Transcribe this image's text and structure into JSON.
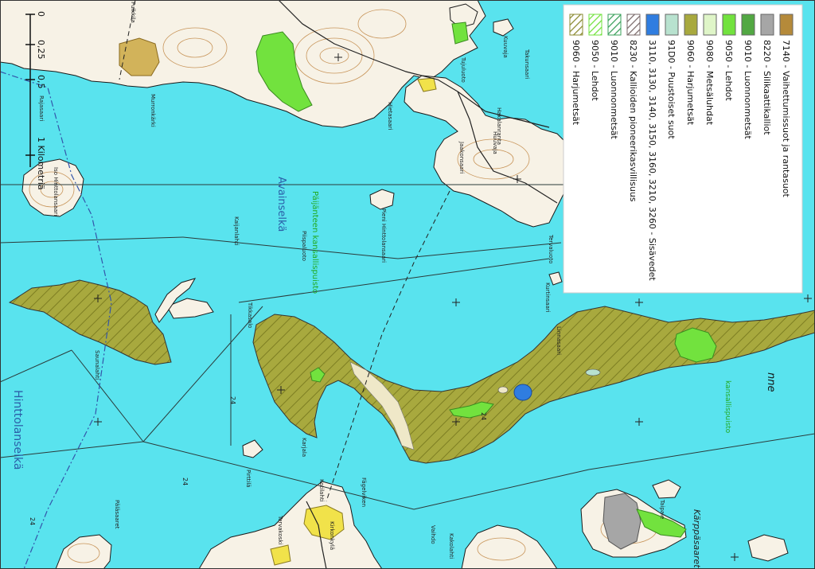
{
  "legend": {
    "items": [
      {
        "code_label": "7140 - Vaihettumissuot ja rantasuot",
        "color": "#b58a3a",
        "pattern": "solid"
      },
      {
        "code_label": "8220 - Silikaattikalliot",
        "color": "#a6a6a6",
        "pattern": "solid"
      },
      {
        "code_label": "9010 - Luonnonmetsät",
        "color": "#52a843",
        "pattern": "solid"
      },
      {
        "code_label": "9050 - Lehdot",
        "color": "#72e23e",
        "pattern": "solid"
      },
      {
        "code_label": "9080 - Metsäluhdat",
        "color": "#dff5c8",
        "pattern": "solid"
      },
      {
        "code_label": "9060 - Harjumetsät",
        "color": "#a8a93e",
        "pattern": "solid"
      },
      {
        "code_label": "91D0 - Puustoiset suot",
        "color": "#b8e2cf",
        "pattern": "solid"
      },
      {
        "code_label": "3110, 3130, 3140, 3150, 3160, 3210, 3260 - Sisävedet",
        "color": "#2f7de0",
        "pattern": "solid"
      },
      {
        "code_label": "8230 - Kallioiden pioneerikasvillisuus",
        "color": "#7a6a6a",
        "pattern": "hatch"
      },
      {
        "code_label": "9010 - Luonnonmetsät",
        "color": "#3aa05a",
        "pattern": "hatch"
      },
      {
        "code_label": "9050 - Lehdot",
        "color": "#72e23e",
        "pattern": "hatch"
      },
      {
        "code_label": "9060 - Harjumetsät",
        "color": "#8a8a30",
        "pattern": "hatch"
      }
    ]
  },
  "scale_bar": {
    "tick_0": "0",
    "tick_025": "0,25",
    "tick_05": "0,5",
    "tick_1": "1 Kilometriä"
  },
  "water_labels": {
    "avainselka": "Avainselkä",
    "hinttolanselka": "Hinttolanselkä",
    "nne": "nne"
  },
  "park_labels": {
    "paijanne_kansallispuisto": "Päijänteen kansallispuisto",
    "kansallispuisto": "kansallispuisto"
  },
  "place_labels": {
    "murronkarki": "Murronkärki",
    "rajasaari": "Rajasaari",
    "isosaari": "Iso Hinttolansaari",
    "pieni_hinttola": "Pieni Hinttolansaari",
    "kaijanlahti": "Kaijanlahti",
    "piispaluoto": "Piispaluoto",
    "tikkasalo": "Tikkasalo",
    "palasaaret": "Päläsaaret",
    "karppasaaret": "Kärppäsaaret",
    "kurtinsaari": "Kurtinsaari",
    "hakalanranta": "Hakalanranta",
    "huuvaja": "Huuvaja",
    "tervaluoto": "Tervaluoto",
    "linnasaari": "Linnasaari",
    "jaakonsaari": "Jaakonsaari",
    "karjala": "Karjala",
    "pirttila": "Pirttilä",
    "kotilahti": "Kotilahti",
    "pulkkila": "Pulkkila",
    "hietasaari": "Hietasaari",
    "kuuvaja": "Kuuvaja",
    "takunsaari": "Takunsaari",
    "tujuluoto": "Tujuluoto",
    "fagelviken": "Fägelviken",
    "kirkonkyla": "Kirkonkylä",
    "tervakoski": "Tervakoski",
    "vaihdo": "Vaihdo",
    "kakolahti": "Kakolahti",
    "taipale": "Taipale",
    "saunalahti": "Saunalahti"
  },
  "depth_labels": {
    "d24a": "24",
    "d24b": "24",
    "d24c": "24",
    "d24d": "24"
  },
  "colors": {
    "water": "#59e3ee",
    "land": "#f7f2e6",
    "harjumetsat": "#a8a93e",
    "lehdot": "#72e23e",
    "contour": "#c8955a",
    "road": "#222222",
    "boundary": "#3355aa",
    "village": "#f1e24a",
    "sisavedet": "#2f7de0",
    "kallio": "#a6a6a6"
  }
}
